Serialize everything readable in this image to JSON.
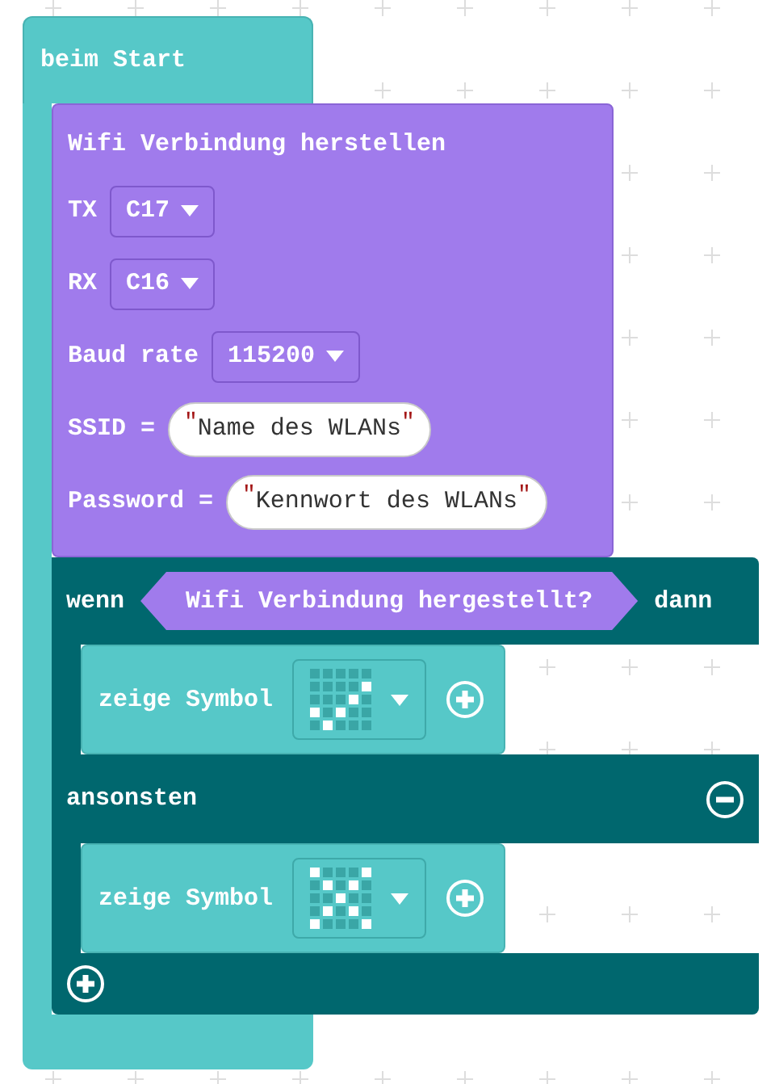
{
  "start_block": {
    "label": "beim Start"
  },
  "wifi_block": {
    "title": "Wifi Verbindung herstellen",
    "params": [
      {
        "kind": "dropdown",
        "label": "TX",
        "value": "C17"
      },
      {
        "kind": "dropdown",
        "label": "RX",
        "value": "C16"
      },
      {
        "kind": "dropdown",
        "label": "Baud rate",
        "value": "115200"
      },
      {
        "kind": "string",
        "label": "SSID =",
        "value": "Name des WLANs",
        "quote": "\""
      },
      {
        "kind": "string",
        "label": "Password =",
        "value": "Kennwort des WLANs",
        "quote": "\""
      }
    ]
  },
  "if_block": {
    "if_label": "wenn",
    "condition": "Wifi Verbindung hergestellt?",
    "then_label": "dann",
    "then_statements": [
      {
        "label": "zeige Symbol",
        "leds": [
          [
            false,
            false,
            false,
            false,
            false
          ],
          [
            false,
            false,
            false,
            false,
            true
          ],
          [
            false,
            false,
            false,
            true,
            false
          ],
          [
            true,
            false,
            true,
            false,
            false
          ],
          [
            false,
            true,
            false,
            false,
            false
          ]
        ]
      }
    ],
    "else_label": "ansonsten",
    "else_statements": [
      {
        "label": "zeige Symbol",
        "leds": [
          [
            true,
            false,
            false,
            false,
            true
          ],
          [
            false,
            true,
            false,
            true,
            false
          ],
          [
            false,
            false,
            true,
            false,
            false
          ],
          [
            false,
            true,
            false,
            true,
            false
          ],
          [
            true,
            false,
            false,
            false,
            true
          ]
        ]
      }
    ]
  }
}
